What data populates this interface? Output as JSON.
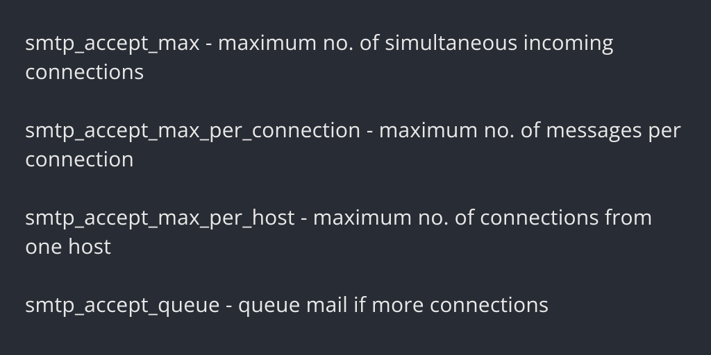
{
  "configs": [
    {
      "text": "smtp_accept_max - maximum no. of simultaneous incoming connections"
    },
    {
      "text": "smtp_accept_max_per_connection - maximum no. of messages per connection"
    },
    {
      "text": "smtp_accept_max_per_host - maximum no. of connections from one host"
    },
    {
      "text": "smtp_accept_queue - queue mail if more connections"
    }
  ]
}
